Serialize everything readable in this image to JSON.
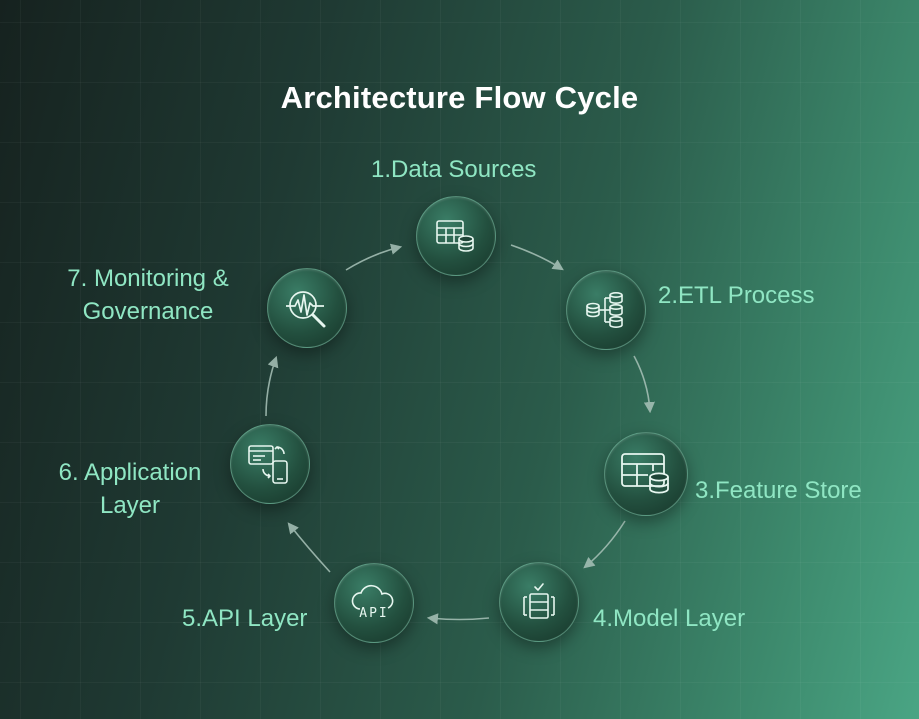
{
  "title": "Architecture Flow Cycle",
  "colors": {
    "label": "#8fe6c3",
    "title": "#ffffff",
    "node_border": "#96e1c3",
    "arrow": "#a9c3b9"
  },
  "nodes": [
    {
      "label": "1.Data Sources",
      "icon": "table-database-icon"
    },
    {
      "label": "2.ETL Process",
      "icon": "etl-pipeline-icon"
    },
    {
      "label": "3.Feature Store",
      "icon": "feature-table-database-icon"
    },
    {
      "label": "4.Model Layer",
      "icon": "model-stack-check-icon"
    },
    {
      "label": "5.API Layer",
      "icon": "cloud-api-icon"
    },
    {
      "label": "6.  Application",
      "label_line2": "Layer",
      "icon": "app-sync-icon"
    },
    {
      "label": "7.  Monitoring &",
      "label_line2": "Governance",
      "icon": "monitoring-search-icon"
    }
  ]
}
